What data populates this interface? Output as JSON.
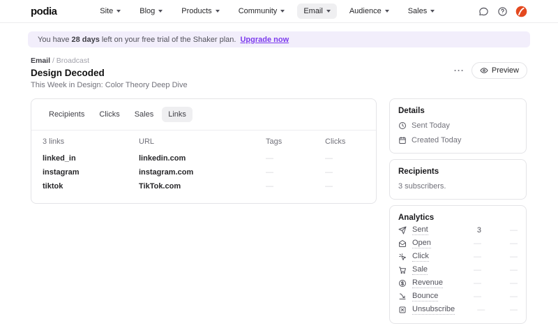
{
  "header": {
    "logo": "podia",
    "nav_items": [
      {
        "label": "Site"
      },
      {
        "label": "Blog"
      },
      {
        "label": "Products"
      },
      {
        "label": "Community"
      },
      {
        "label": "Email"
      },
      {
        "label": "Audience"
      },
      {
        "label": "Sales"
      }
    ]
  },
  "banner": {
    "text_pre": "You have",
    "text_bold": "28 days",
    "text_post": "left on your free trial of the Shaker plan.",
    "link_label": "Upgrade now"
  },
  "page_header": {
    "breadcrumb": {
      "section": "Email",
      "separator": "/",
      "current": "Broadcast"
    },
    "title": "Design Decoded",
    "subtitle": "This Week in Design: Color Theory Deep Dive",
    "more_label": "···",
    "preview_label": "Preview"
  },
  "main": {
    "tabs": [
      {
        "label": "Recipients"
      },
      {
        "label": "Clicks"
      },
      {
        "label": "Sales"
      },
      {
        "label": "Links"
      }
    ],
    "active_tab": "Links",
    "table": {
      "headers": {
        "links_count": "3 links",
        "url": "URL",
        "tags": "Tags",
        "clicks": "Clicks"
      },
      "rows": [
        {
          "name": "linked_in",
          "url": "linkedin.com",
          "tags": "—",
          "clicks": "—"
        },
        {
          "name": "instagram",
          "url": "instagram.com",
          "tags": "—",
          "clicks": "—"
        },
        {
          "name": "tiktok",
          "url": "TikTok.com",
          "tags": "—",
          "clicks": "—"
        }
      ]
    }
  },
  "sidebar": {
    "details": {
      "title": "Details",
      "items": [
        {
          "icon": "clock-icon",
          "label": "Sent Today"
        },
        {
          "icon": "calendar-icon",
          "label": "Created Today"
        }
      ]
    },
    "recipients": {
      "title": "Recipients",
      "text": "3 subscribers."
    },
    "analytics": {
      "title": "Analytics",
      "rows": [
        {
          "icon": "send-icon",
          "label": "Sent",
          "value": "3",
          "secondary": "—"
        },
        {
          "icon": "envelope-open-icon",
          "label": "Open",
          "value": "—",
          "secondary": "—"
        },
        {
          "icon": "cursor-click-icon",
          "label": "Click",
          "value": "—",
          "secondary": "—"
        },
        {
          "icon": "cart-icon",
          "label": "Sale",
          "value": "—",
          "secondary": "—"
        },
        {
          "icon": "dollar-circle-icon",
          "label": "Revenue",
          "value": "—",
          "secondary": "—"
        },
        {
          "icon": "bounce-icon",
          "label": "Bounce",
          "value": "—",
          "secondary": "—"
        },
        {
          "icon": "unsubscribe-icon",
          "label": "Unsubscribe",
          "value": "—",
          "secondary": "—"
        }
      ]
    }
  },
  "colors": {
    "accent_purple": "#7c3aed",
    "banner_bg": "#f2eefb",
    "avatar_orange": "#e4491f",
    "active_pill_bg": "#efeff1"
  }
}
